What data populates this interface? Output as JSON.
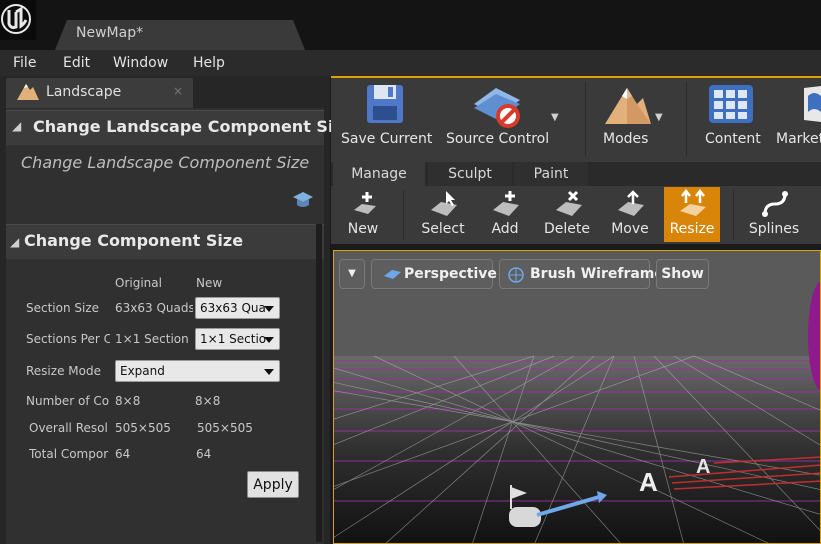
{
  "window": {
    "doc_tab": "NewMap*"
  },
  "menu": [
    "File",
    "Edit",
    "Window",
    "Help"
  ],
  "panel": {
    "tab_label": "Landscape",
    "tab_close": "×",
    "section_title": "Change Landscape Component Size",
    "subtitle": "Change Landscape Component Size",
    "group_title": "Change Component Size",
    "col_original": "Original",
    "col_new": "New",
    "rows": [
      {
        "label": "Section Size",
        "original": "63x63 Quads",
        "new": "63x63 Qua"
      },
      {
        "label": "Sections Per C",
        "original": "1×1 Section",
        "new": "1×1 Sectio"
      },
      {
        "label": "Resize Mode",
        "new": "Expand"
      },
      {
        "label": "Number of Cor",
        "original": "8×8",
        "new": "8×8"
      },
      {
        "label": "Overall Resol",
        "original": "505×505",
        "new": "505×505"
      },
      {
        "label": "Total Compor",
        "original": "64",
        "new": "64"
      }
    ],
    "apply_label": "Apply"
  },
  "toolbar": {
    "save": "Save Current",
    "source": "Source Control",
    "modes": "Modes",
    "content": "Content",
    "market": "Market"
  },
  "mode_tabs": [
    "Manage",
    "Sculpt",
    "Paint"
  ],
  "tools": [
    "New",
    "Select",
    "Add",
    "Delete",
    "Move",
    "Resize",
    "Splines"
  ],
  "viewport": {
    "perspective": "Perspective",
    "wireframe": "Brush Wireframe",
    "show": "Show"
  },
  "colors": {
    "accent_orange": "#d8850a",
    "selection_gold": "#d9a400",
    "wire_magenta": "#9b2fa3"
  }
}
